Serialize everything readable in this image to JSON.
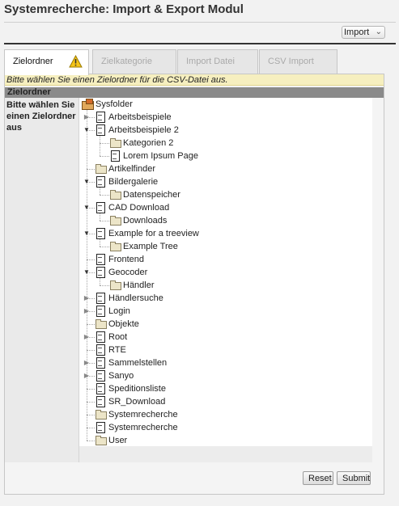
{
  "header": {
    "title": "Systemrecherche: Import & Export Modul"
  },
  "toolbar": {
    "import_select_value": "Import",
    "import_select_icon": "chevron-down-icon"
  },
  "tabs": [
    {
      "label": "Zielordner",
      "active": true,
      "icon": "warning-icon"
    },
    {
      "label": "Zielkategorie",
      "active": false
    },
    {
      "label": "Import Datei",
      "active": false
    },
    {
      "label": "CSV Import",
      "active": false
    }
  ],
  "notice": "Bitte wählen Sie einen Zielordner für die CSV-Datei aus.",
  "section": {
    "title": "Zielordner",
    "field_label": "Bitte wählen Sie einen Zielordner aus"
  },
  "tree": [
    {
      "label": "Sysfolder",
      "icon": "sysfolder-icon",
      "toggle": "none"
    },
    {
      "label": "Arbeitsbeispiele",
      "icon": "page-icon",
      "toggle": "collapsed"
    },
    {
      "label": "Arbeitsbeispiele 2",
      "icon": "page-icon",
      "toggle": "expanded"
    },
    {
      "label": "Kategorien 2",
      "icon": "folder-icon",
      "toggle": "none"
    },
    {
      "label": "Lorem Ipsum Page",
      "icon": "page-icon",
      "toggle": "none"
    },
    {
      "label": "Artikelfinder",
      "icon": "folder-icon",
      "toggle": "none"
    },
    {
      "label": "Bildergalerie",
      "icon": "page-icon",
      "toggle": "expanded"
    },
    {
      "label": "Datenspeicher",
      "icon": "folder-icon",
      "toggle": "none"
    },
    {
      "label": "CAD Download",
      "icon": "page-icon",
      "toggle": "expanded"
    },
    {
      "label": "Downloads",
      "icon": "folder-icon",
      "toggle": "none"
    },
    {
      "label": "Example for a treeview",
      "icon": "page-icon",
      "toggle": "expanded"
    },
    {
      "label": "Example Tree",
      "icon": "folder-icon",
      "toggle": "none"
    },
    {
      "label": "Frontend",
      "icon": "page-icon",
      "toggle": "none"
    },
    {
      "label": "Geocoder",
      "icon": "page-icon",
      "toggle": "expanded"
    },
    {
      "label": "Händler",
      "icon": "folder-icon",
      "toggle": "none"
    },
    {
      "label": "Händlersuche",
      "icon": "page-icon",
      "toggle": "collapsed"
    },
    {
      "label": "Login",
      "icon": "page-icon",
      "toggle": "collapsed"
    },
    {
      "label": "Objekte",
      "icon": "folder-icon",
      "toggle": "none"
    },
    {
      "label": "Root",
      "icon": "page-icon",
      "toggle": "collapsed"
    },
    {
      "label": "RTE",
      "icon": "page-icon",
      "toggle": "none"
    },
    {
      "label": "Sammelstellen",
      "icon": "page-icon",
      "toggle": "collapsed"
    },
    {
      "label": "Sanyo",
      "icon": "page-icon",
      "toggle": "collapsed"
    },
    {
      "label": "Speditionsliste",
      "icon": "page-icon",
      "toggle": "none"
    },
    {
      "label": "SR_Download",
      "icon": "page-icon",
      "toggle": "none"
    },
    {
      "label": "Systemrecherche",
      "icon": "folder-icon",
      "toggle": "none"
    },
    {
      "label": "Systemrecherche",
      "icon": "page-icon",
      "toggle": "none"
    },
    {
      "label": "User",
      "icon": "folder-icon",
      "toggle": "none"
    }
  ],
  "buttons": {
    "reset": "Reset",
    "submit": "Submit"
  }
}
